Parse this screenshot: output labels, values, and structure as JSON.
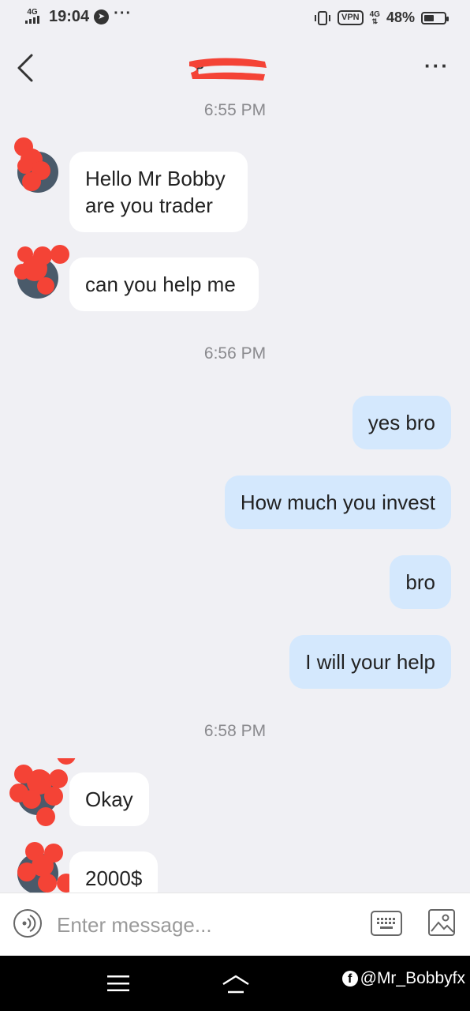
{
  "status_bar": {
    "network_type": "4G",
    "time": "19:04",
    "more_indicator": "···",
    "vpn_label": "VPN",
    "network_type_right": "4G",
    "battery_percent": "48%",
    "battery_level": 0.48
  },
  "header": {
    "contact_name": "P",
    "more_label": "···"
  },
  "messages": [
    {
      "type": "timestamp",
      "text": "6:55 PM"
    },
    {
      "type": "incoming",
      "text": "Hello Mr Bobby are you trader"
    },
    {
      "type": "incoming",
      "text": "can you help me"
    },
    {
      "type": "timestamp",
      "text": "6:56 PM"
    },
    {
      "type": "outgoing",
      "text": "yes bro"
    },
    {
      "type": "outgoing",
      "text": "How much you invest"
    },
    {
      "type": "outgoing",
      "text": "bro"
    },
    {
      "type": "outgoing",
      "text": "I will your help"
    },
    {
      "type": "timestamp",
      "text": "6:58 PM"
    },
    {
      "type": "incoming",
      "text": "Okay"
    },
    {
      "type": "incoming",
      "text": "2000$"
    }
  ],
  "composer": {
    "placeholder": "Enter message...",
    "value": ""
  },
  "watermark": {
    "icon": "facebook-icon",
    "text": "@Mr_Bobbyfx"
  },
  "colors": {
    "background": "#f0f0f4",
    "incoming_bubble": "#ffffff",
    "outgoing_bubble": "#d4e8fd",
    "redaction": "#f44336"
  }
}
